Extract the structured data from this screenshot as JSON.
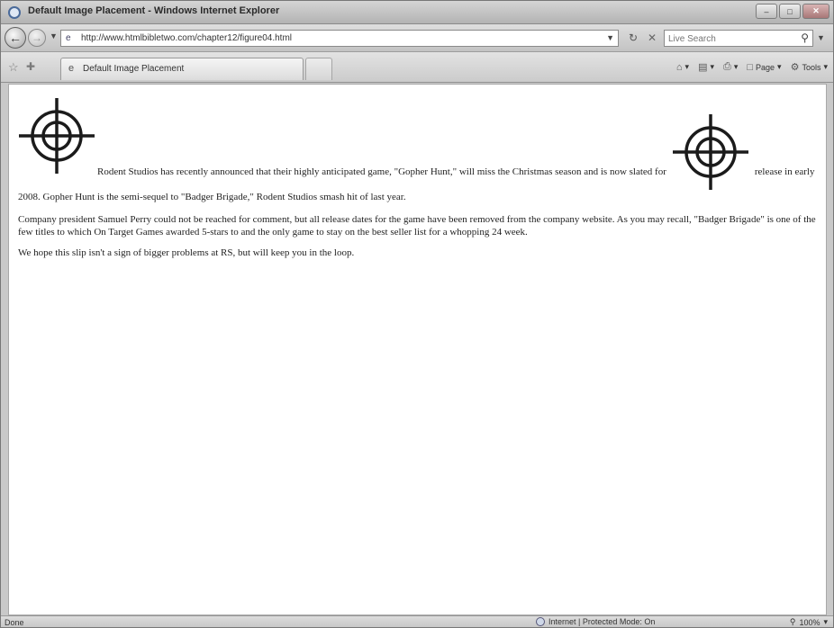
{
  "window": {
    "title": "Default Image Placement - Windows Internet Explorer"
  },
  "address_bar": {
    "url": "http://www.htmlbibletwo.com/chapter12/figure04.html",
    "search_placeholder": "Live Search"
  },
  "tab": {
    "label": "Default Image Placement"
  },
  "command_bar": {
    "page_label": "Page",
    "tools_label": "Tools"
  },
  "content": {
    "para1_part1": "Rodent Studios has recently announced that their highly anticipated game, \"Gopher Hunt,\" will miss the Christmas season and is now slated for",
    "para1_part2": "release in early 2008. Gopher Hunt is the semi-sequel to \"Badger Brigade,\" Rodent Studios smash hit of last year.",
    "para2": "Company president Samuel Perry could not be reached for comment, but all release dates for the game have been removed from the company website. As you may recall, \"Badger Brigade\" is one of the few titles to which On Target Games awarded 5-stars to and the only game to stay on the best seller list for a whopping 24 week.",
    "para3": "We hope this slip isn't a sign of bigger problems at RS, but will keep you in the loop."
  },
  "status_bar": {
    "status": "Done",
    "zone": "Internet | Protected Mode: On",
    "zoom": "100%"
  },
  "icons": {
    "target": "crosshair-target-icon",
    "search": "magnifier-icon",
    "ie": "ie-logo-icon"
  }
}
